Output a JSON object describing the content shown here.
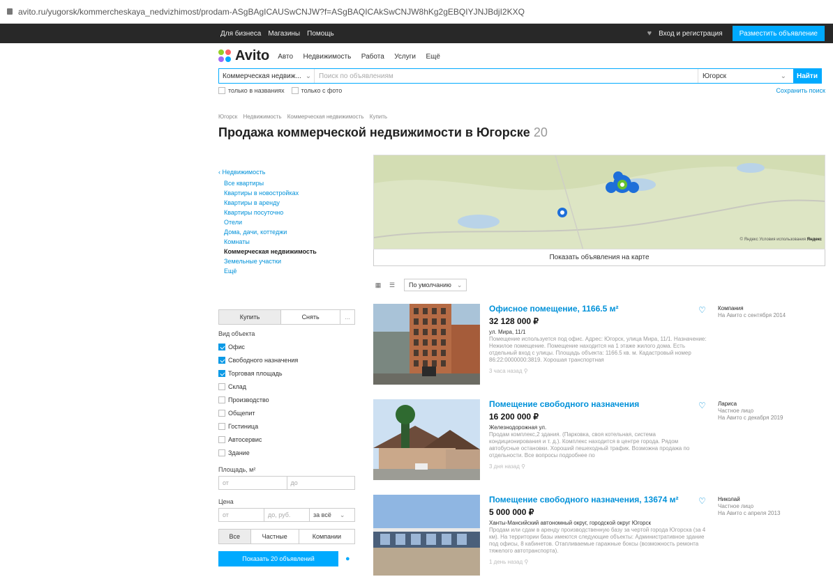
{
  "browser": {
    "url": "avito.ru/yugorsk/kommercheskaya_nedvizhimost/prodam-ASgBAgICAUSwCNJW?f=ASgBAQICAkSwCNJW8hKg2gEBQIYJNJBdjI2KXQ"
  },
  "topbar": {
    "links": [
      "Для бизнеса",
      "Магазины",
      "Помощь"
    ],
    "login": "Вход и регистрация",
    "post_ad": "Разместить объявление"
  },
  "header": {
    "logo": "Avito",
    "nav": [
      "Авто",
      "Недвижимость",
      "Работа",
      "Услуги",
      "Ещё"
    ]
  },
  "search": {
    "category": "Коммерческая недвиж...",
    "placeholder": "Поиск по объявлениям",
    "city": "Югорск",
    "button": "Найти",
    "only_titles": "только в названиях",
    "only_photo": "только с фото",
    "save": "Сохранить поиск"
  },
  "breadcrumbs": [
    "Югорск",
    "Недвижимость",
    "Коммерческая недвижимость",
    "Купить"
  ],
  "page": {
    "title": "Продажа коммерческой недвижимости в Югорске",
    "count": "20"
  },
  "categories": {
    "root": "Недвижимость",
    "items": [
      "Все квартиры",
      "Квартиры в новостройках",
      "Квартиры в аренду",
      "Квартиры посуточно",
      "Отели",
      "Дома, дачи, коттеджи",
      "Комнаты",
      "Коммерческая недвижимость",
      "Земельные участки",
      "Ещё"
    ],
    "active_index": 7
  },
  "filters": {
    "deal_tabs": [
      "Купить",
      "Снять",
      "..."
    ],
    "object_type_label": "Вид объекта",
    "object_types": [
      {
        "label": "Офис",
        "checked": true
      },
      {
        "label": "Свободного назначения",
        "checked": true
      },
      {
        "label": "Торговая площадь",
        "checked": true
      },
      {
        "label": "Склад",
        "checked": false
      },
      {
        "label": "Производство",
        "checked": false
      },
      {
        "label": "Общепит",
        "checked": false
      },
      {
        "label": "Гостиница",
        "checked": false
      },
      {
        "label": "Автосервис",
        "checked": false
      },
      {
        "label": "Здание",
        "checked": false
      }
    ],
    "area_label": "Площадь, м²",
    "from": "от",
    "to": "до",
    "price_label": "Цена",
    "price_to": "до, руб.",
    "price_scope": "за всё",
    "seller_tabs": [
      "Все",
      "Частные",
      "Компании"
    ],
    "show_button": "Показать 20 объявлений"
  },
  "map": {
    "show_on_map": "Показать объявления на карте",
    "attribution": "© Яндекс Условия использования",
    "yandex": "Яндекс"
  },
  "sort": {
    "label": "По умолчанию"
  },
  "listings": [
    {
      "title": "Офисное помещение, 1166.5 м²",
      "price": "32 128 000 ₽",
      "address": "ул. Мира, 11/1",
      "description": "Помещение используется под офис. Адрес: Югорск, улица Мира, 11/1. Назначение: Нежилое помещение. Помещение находится на 1 этаже жилого дома. Есть отдельный вход с улицы. Площадь объекта: 1166.5 кв. м. Кадастровый номер 86:22:0000000:3819. Хорошая транспортная",
      "time": "3 часа назад",
      "seller_name": "Компания",
      "seller_type": "",
      "seller_since": "На Авито с сентября 2014"
    },
    {
      "title": "Помещение свободного назначения",
      "price": "16 200 000 ₽",
      "address": "Железнодорожная ул.",
      "description": "Продам комплекс,2 здания. (Парковка, своя котельная, система кондиционирования и т. д.). Комплекс находится в центре города. Рядом автобусные остановки. Хороший пешеходный трафик. Возможна продажа по отдельности. Все вопросы подробнее по",
      "time": "3 дня назад",
      "seller_name": "Лариса",
      "seller_type": "Частное лицо",
      "seller_since": "На Авито с декабря 2019"
    },
    {
      "title": "Помещение свободного назначения, 13674 м²",
      "price": "5 000 000 ₽",
      "address": "Ханты-Мансийский автономный округ, городской округ Югорск",
      "description": "Продам или сдам в аренду производственную базу за чертой города Югорска (за 4 км). На территории базы имеются следующие объекты: Административное здание под офисы, 8 кабинетов. Отапливаемые гаражные боксы (возможность ремонта тяжелого автотранспорта).",
      "time": "1 день назад",
      "seller_name": "Николай",
      "seller_type": "Частное лицо",
      "seller_since": "На Авито с апреля 2013"
    }
  ]
}
